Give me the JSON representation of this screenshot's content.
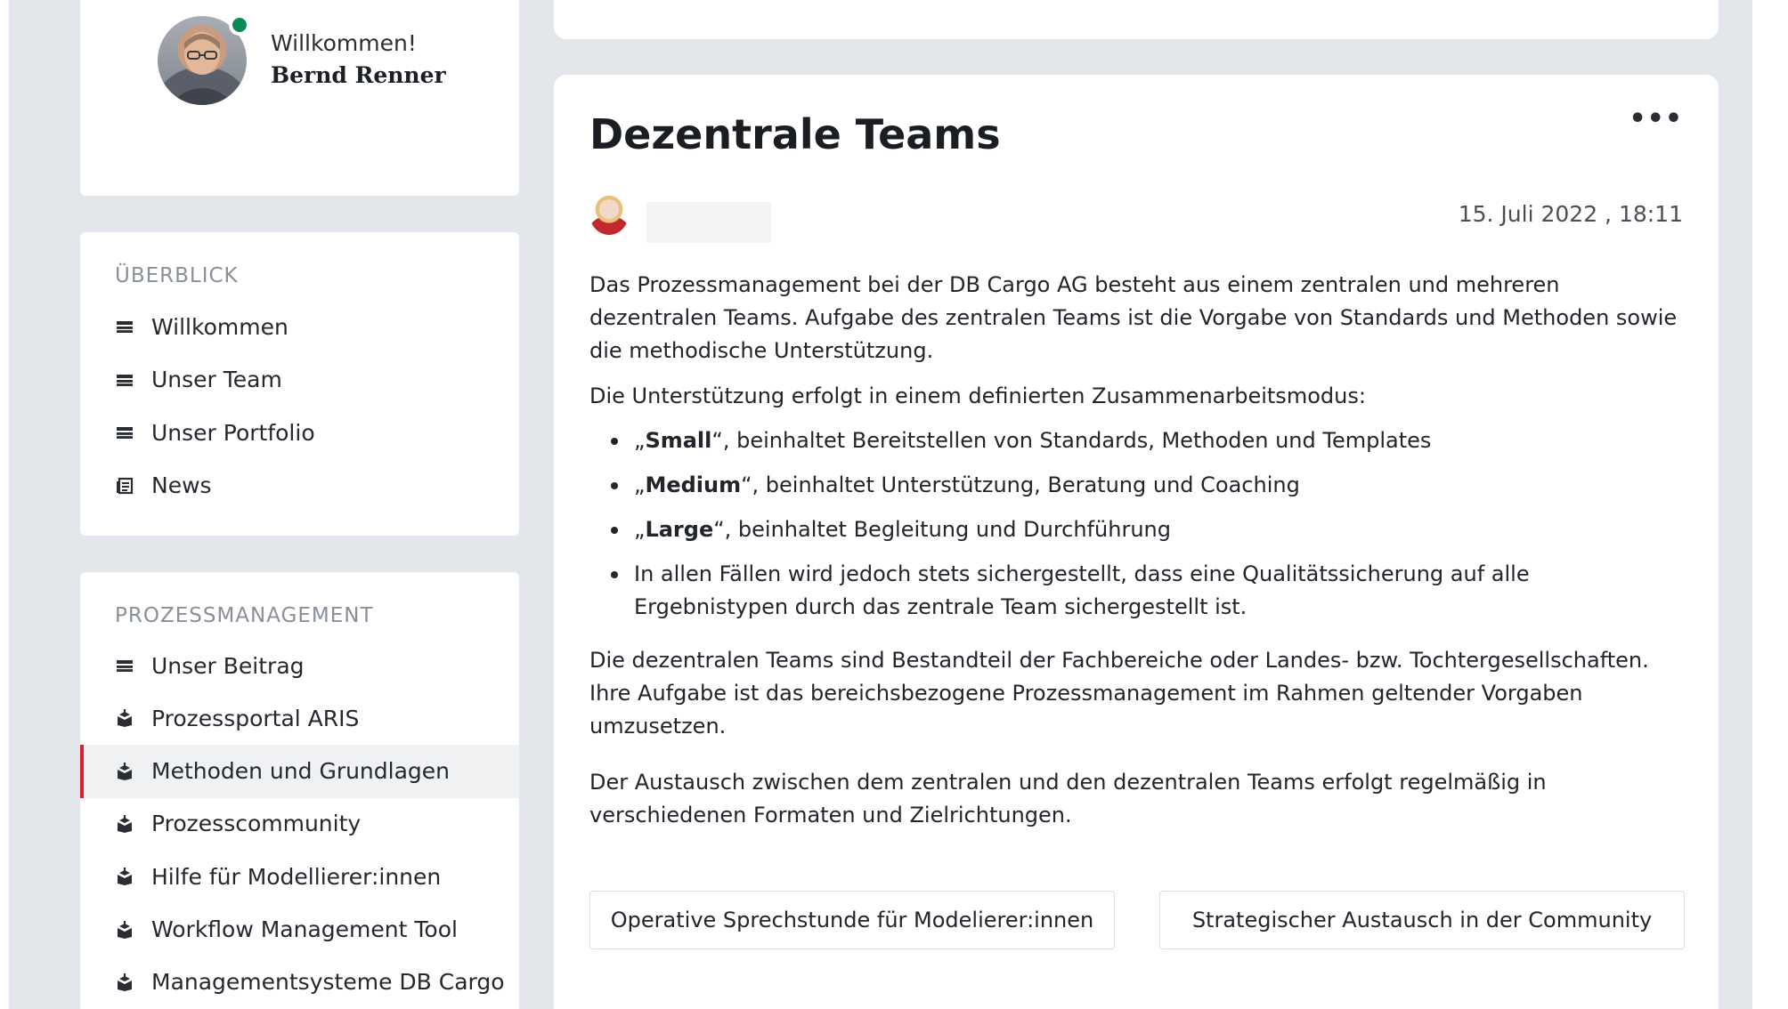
{
  "profile": {
    "welcome": "Willkommen!",
    "name": "Bernd Renner",
    "status": "online"
  },
  "overview": {
    "title": "ÜBERBLICK",
    "items": [
      {
        "label": "Willkommen",
        "icon": "page-icon"
      },
      {
        "label": "Unser Team",
        "icon": "page-icon"
      },
      {
        "label": "Unser Portfolio",
        "icon": "page-icon"
      },
      {
        "label": "News",
        "icon": "news-icon"
      }
    ]
  },
  "process": {
    "title": "PROZESSMANAGEMENT",
    "items": [
      {
        "label": "Unser Beitrag",
        "icon": "page-icon"
      },
      {
        "label": "Prozessportal ARIS",
        "icon": "box-icon"
      },
      {
        "label": "Methoden und Grundlagen",
        "icon": "box-icon",
        "active": true
      },
      {
        "label": "Prozesscommunity",
        "icon": "box-icon"
      },
      {
        "label": "Hilfe für Modellierer:innen",
        "icon": "box-icon"
      },
      {
        "label": "Workflow Management Tool",
        "icon": "box-icon"
      },
      {
        "label": "Managementsysteme DB Cargo",
        "icon": "box-icon"
      }
    ]
  },
  "article": {
    "title": "Dezentrale Teams",
    "more": "•••",
    "date": "15. Juli 2022 , 18:11",
    "p1": "Das Prozessmanagement bei der DB Cargo AG besteht aus einem zentralen und mehreren dezentralen Teams. Aufgabe des zentralen Teams ist die Vorgabe von Standards und Methoden sowie die methodische Unterstützung.",
    "p2": "Die Unterstützung erfolgt in einem definierten Zusammenarbeitsmodus:",
    "bullets": [
      {
        "open": "„",
        "bold": "Small",
        "close": "“",
        "rest": ", beinhaltet Bereitstellen von Standards, Methoden und Templates"
      },
      {
        "open": "„",
        "bold": "Medium",
        "close": "“",
        "rest": ", beinhaltet Unterstützung, Beratung und Coaching"
      },
      {
        "open": "„",
        "bold": "Large",
        "close": "“",
        "rest": ", beinhaltet Begleitung und Durchführung"
      },
      {
        "open": "",
        "bold": "",
        "close": "",
        "rest": "In allen Fällen wird jedoch stets sichergestellt, dass eine Qualitätssicherung auf alle Ergebnistypen durch das zentrale Team sichergestellt ist."
      }
    ],
    "p3": "Die dezentralen Teams sind Bestandteil der Fachbereiche oder Landes- bzw. Tochtergesellschaften. Ihre Aufgabe ist das bereichsbezogene Prozessmanagement im Rahmen geltender Vorgaben umzusetzen.",
    "p4": "Der Austausch zwischen dem zentralen und den dezentralen Teams erfolgt regelmäßig in verschiedenen Formaten und Zielrichtungen.",
    "buttons": [
      "Operative Sprechstunde für Modelierer:innen",
      "Strategischer Austausch in der Community"
    ]
  },
  "colors": {
    "accent": "#e01e2d",
    "online": "#0b8a58",
    "background": "#e3e6ea"
  }
}
